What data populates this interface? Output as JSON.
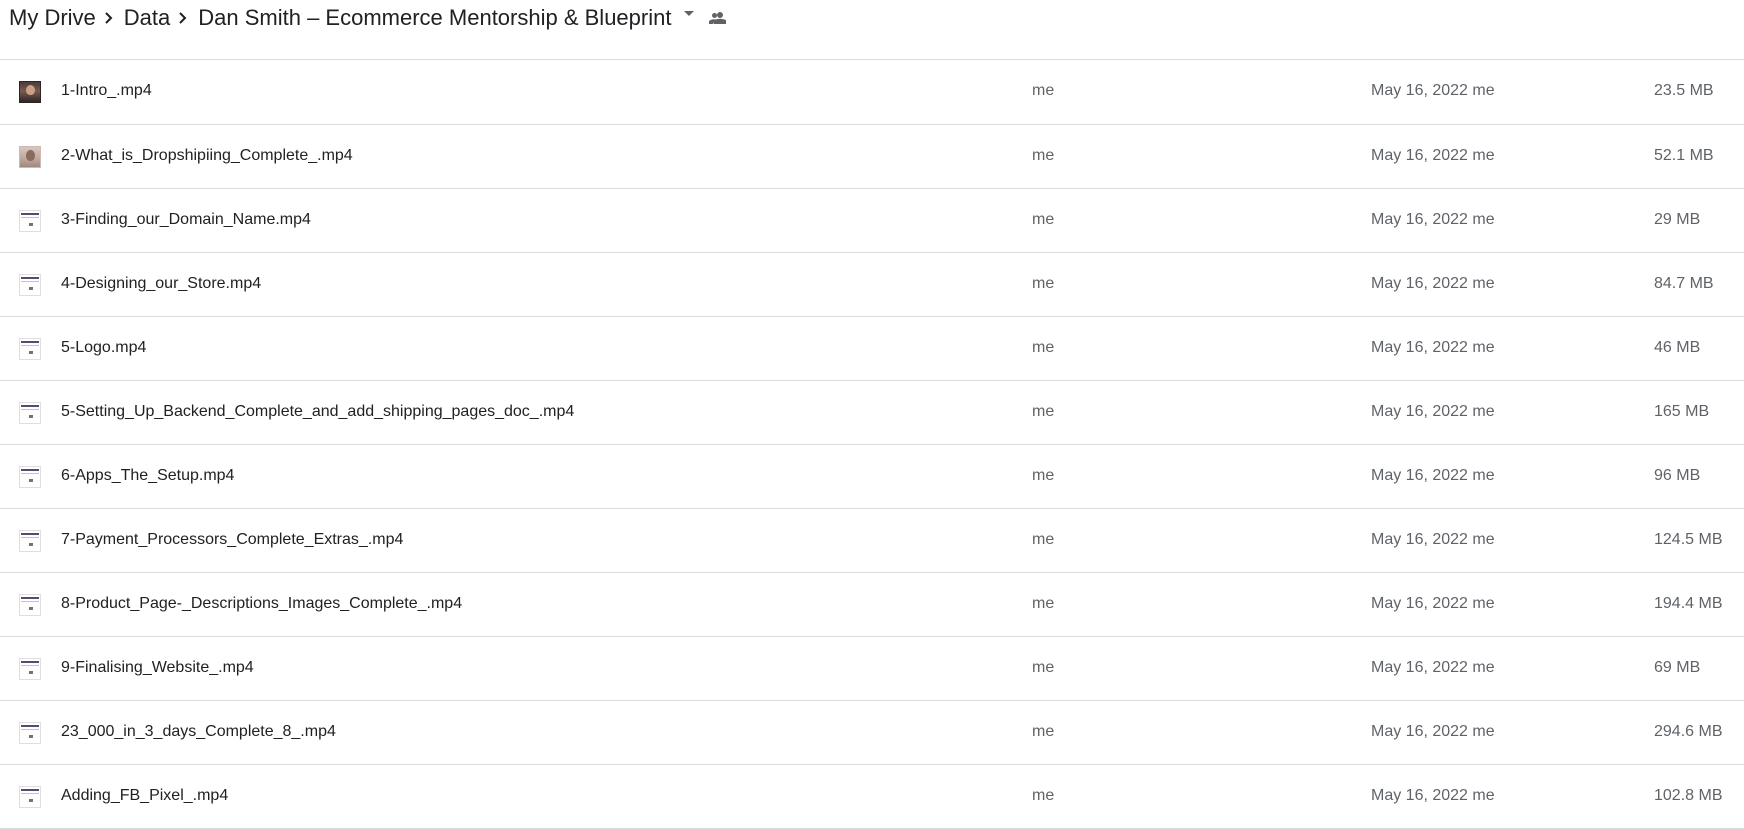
{
  "breadcrumb": {
    "items": [
      "My Drive",
      "Data",
      "Dan Smith – Ecommerce Mentorship & Blueprint"
    ],
    "separator_icon": "chevron-right-icon",
    "dropdown_icon": "caret-down-icon",
    "shared_icon": "people-icon"
  },
  "files": [
    {
      "name": "1-Intro_.mp4",
      "owner": "me",
      "modified": "May 16, 2022 me",
      "size": "23.5 MB",
      "thumb": "photo-a"
    },
    {
      "name": "2-What_is_Dropshipiing_Complete_.mp4",
      "owner": "me",
      "modified": "May 16, 2022 me",
      "size": "52.1 MB",
      "thumb": "photo-b"
    },
    {
      "name": "3-Finding_our_Domain_Name.mp4",
      "owner": "me",
      "modified": "May 16, 2022 me",
      "size": "29 MB",
      "thumb": "screen"
    },
    {
      "name": "4-Designing_our_Store.mp4",
      "owner": "me",
      "modified": "May 16, 2022 me",
      "size": "84.7 MB",
      "thumb": "screen"
    },
    {
      "name": "5-Logo.mp4",
      "owner": "me",
      "modified": "May 16, 2022 me",
      "size": "46 MB",
      "thumb": "screen"
    },
    {
      "name": "5-Setting_Up_Backend_Complete_and_add_shipping_pages_doc_.mp4",
      "owner": "me",
      "modified": "May 16, 2022 me",
      "size": "165 MB",
      "thumb": "screen"
    },
    {
      "name": "6-Apps_The_Setup.mp4",
      "owner": "me",
      "modified": "May 16, 2022 me",
      "size": "96 MB",
      "thumb": "screen"
    },
    {
      "name": "7-Payment_Processors_Complete_Extras_.mp4",
      "owner": "me",
      "modified": "May 16, 2022 me",
      "size": "124.5 MB",
      "thumb": "screen"
    },
    {
      "name": "8-Product_Page-_Descriptions_Images_Complete_.mp4",
      "owner": "me",
      "modified": "May 16, 2022 me",
      "size": "194.4 MB",
      "thumb": "screen"
    },
    {
      "name": "9-Finalising_Website_.mp4",
      "owner": "me",
      "modified": "May 16, 2022 me",
      "size": "69 MB",
      "thumb": "screen"
    },
    {
      "name": "23_000_in_3_days_Complete_8_.mp4",
      "owner": "me",
      "modified": "May 16, 2022 me",
      "size": "294.6 MB",
      "thumb": "screen"
    },
    {
      "name": "Adding_FB_Pixel_.mp4",
      "owner": "me",
      "modified": "May 16, 2022 me",
      "size": "102.8 MB",
      "thumb": "screen"
    }
  ]
}
